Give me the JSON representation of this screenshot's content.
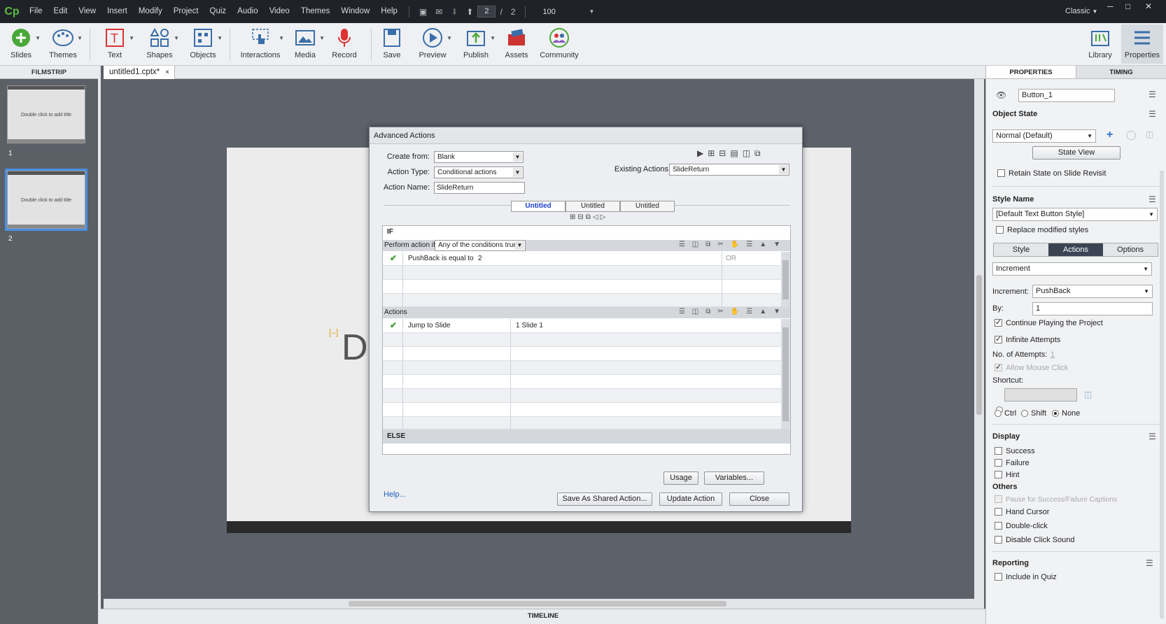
{
  "app": {
    "logo": "Cp",
    "menu": [
      "File",
      "Edit",
      "View",
      "Insert",
      "Modify",
      "Project",
      "Quiz",
      "Audio",
      "Video",
      "Themes",
      "Window",
      "Help"
    ],
    "current_page": "2",
    "page_sep": "/",
    "total_pages": "2",
    "zoom": "100",
    "workspace": "Classic"
  },
  "toolbar": {
    "slides": "Slides",
    "themes": "Themes",
    "text": "Text",
    "shapes": "Shapes",
    "objects": "Objects",
    "interactions": "Interactions",
    "media": "Media",
    "record": "Record",
    "save": "Save",
    "preview": "Preview",
    "publish": "Publish",
    "assets": "Assets",
    "community": "Community",
    "library": "Library",
    "properties": "Properties"
  },
  "filmstrip": {
    "header": "FILMSTRIP",
    "slides": [
      {
        "num": "1",
        "text": "Double click to add title"
      },
      {
        "num": "2",
        "text": "Double click to add title"
      }
    ]
  },
  "document": {
    "tab": "untitled1.cptx*",
    "close": "×",
    "slide_text": "D",
    "timeline": "TIMELINE"
  },
  "dialog": {
    "title": "Advanced Actions",
    "create_from_label": "Create from:",
    "create_from_value": "Blank",
    "action_type_label": "Action Type:",
    "action_type_value": "Conditional actions",
    "action_name_label": "Action Name:",
    "action_name_value": "SlideReturn",
    "existing_label": "Existing Actions:",
    "existing_value": "SlideReturn",
    "tabs": [
      "Untitled",
      "Untitled",
      "Untitled"
    ],
    "if_label": "IF",
    "perform_label": "Perform action if:",
    "perform_value": "Any of the conditions true",
    "condition": {
      "variable": "PushBack",
      "operator": "is equal to",
      "value": "2",
      "join": "OR"
    },
    "actions_label": "Actions",
    "action_row": {
      "command": "Jump to Slide",
      "target": "1 Slide 1"
    },
    "else_label": "ELSE",
    "help": "Help...",
    "usage": "Usage",
    "variables": "Variables...",
    "save_shared": "Save As Shared Action...",
    "update": "Update Action",
    "close": "Close"
  },
  "properties": {
    "tab_properties": "PROPERTIES",
    "tab_timing": "TIMING",
    "name": "Button_1",
    "object_state": "Object State",
    "state_value": "Normal (Default)",
    "state_view": "State View",
    "retain_state": "Retain State on Slide Revisit",
    "style_name": "Style Name",
    "style_value": "[Default Text Button Style]",
    "replace_styles": "Replace modified styles",
    "seg_style": "Style",
    "seg_actions": "Actions",
    "seg_options": "Options",
    "action_value": "Increment",
    "increment_label": "Increment:",
    "increment_value": "PushBack",
    "by_label": "By:",
    "by_value": "1",
    "continue_playing": "Continue Playing the Project",
    "infinite_attempts": "Infinite Attempts",
    "attempts_label": "No. of Attempts:",
    "attempts_value": "1",
    "allow_mouse": "Allow Mouse Click",
    "shortcut": "Shortcut:",
    "ctrl": "Ctrl",
    "shift": "Shift",
    "none": "None",
    "display": "Display",
    "success": "Success",
    "failure": "Failure",
    "hint": "Hint",
    "others": "Others",
    "pause": "Pause for Success/Failure Captions",
    "hand_cursor": "Hand Cursor",
    "double_click": "Double-click",
    "disable_sound": "Disable Click Sound",
    "reporting": "Reporting",
    "include_quiz": "Include in Quiz"
  },
  "colors": {
    "accent": "#3c4454",
    "logo": "#5dbf3f",
    "check": "#3aa12a",
    "link": "#2060c0"
  }
}
